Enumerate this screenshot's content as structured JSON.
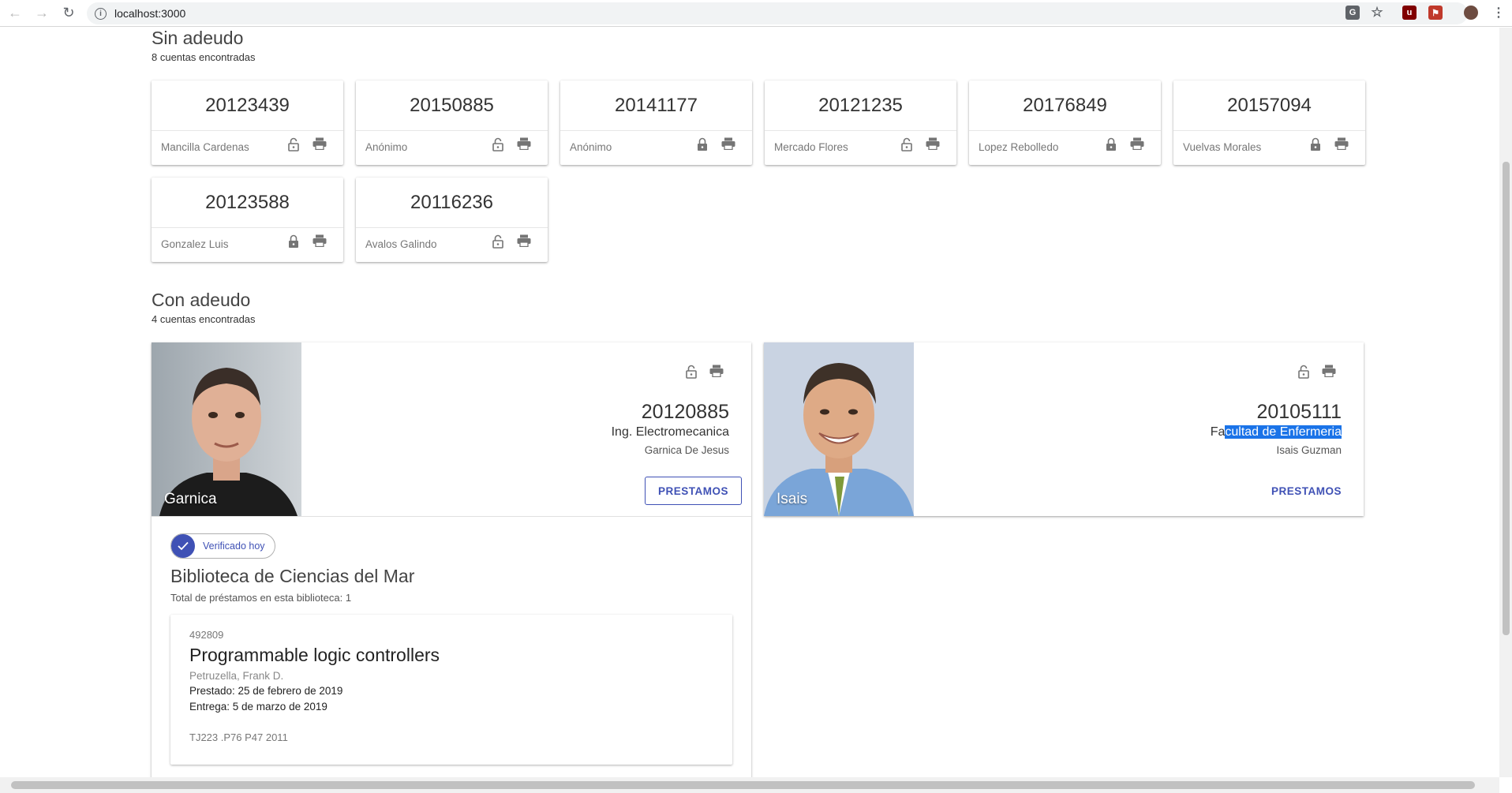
{
  "browser": {
    "url": "localhost:3000"
  },
  "sin_adeudo": {
    "title": "Sin adeudo",
    "count": "8 cuentas encontradas",
    "cards": [
      {
        "number": "20123439",
        "name": "Mancilla Cardenas",
        "locked": false
      },
      {
        "number": "20150885",
        "name": "Anónimo",
        "locked": false
      },
      {
        "number": "20141177",
        "name": "Anónimo",
        "locked": true
      },
      {
        "number": "20121235",
        "name": "Mercado Flores",
        "locked": false
      },
      {
        "number": "20176849",
        "name": "Lopez Rebolledo",
        "locked": true
      },
      {
        "number": "20157094",
        "name": "Vuelvas Morales",
        "locked": true
      },
      {
        "number": "20123588",
        "name": "Gonzalez Luis",
        "locked": true
      },
      {
        "number": "20116236",
        "name": "Avalos Galindo",
        "locked": false
      }
    ]
  },
  "con_adeudo": {
    "title": "Con adeudo",
    "count": "4 cuentas encontradas",
    "accounts": [
      {
        "photo_name": "Garnica",
        "number": "20120885",
        "faculty": "Ing. Electromecanica",
        "person": "Garnica De Jesus",
        "button": "PRESTAMOS",
        "verified": "Verificado hoy",
        "library": "Biblioteca de Ciencias del Mar",
        "library_total": "Total de préstamos en esta biblioteca: 1",
        "book": {
          "id": "492809",
          "title": "Programmable logic controllers",
          "author": "Petruzella, Frank D.",
          "prestado": "Prestado: 25 de febrero de 2019",
          "entrega": "Entrega: 5 de marzo de 2019",
          "call_number": "TJ223 .P76 P47 2011"
        }
      },
      {
        "photo_name": "Isais",
        "number": "20105111",
        "faculty_prefix": "Fa",
        "faculty_selected": "cultad de Enfermeria",
        "person": "Isais Guzman",
        "button": "PRESTAMOS"
      }
    ]
  },
  "colors": {
    "accent": "#3f51b5",
    "selection": "#1a73e8"
  }
}
